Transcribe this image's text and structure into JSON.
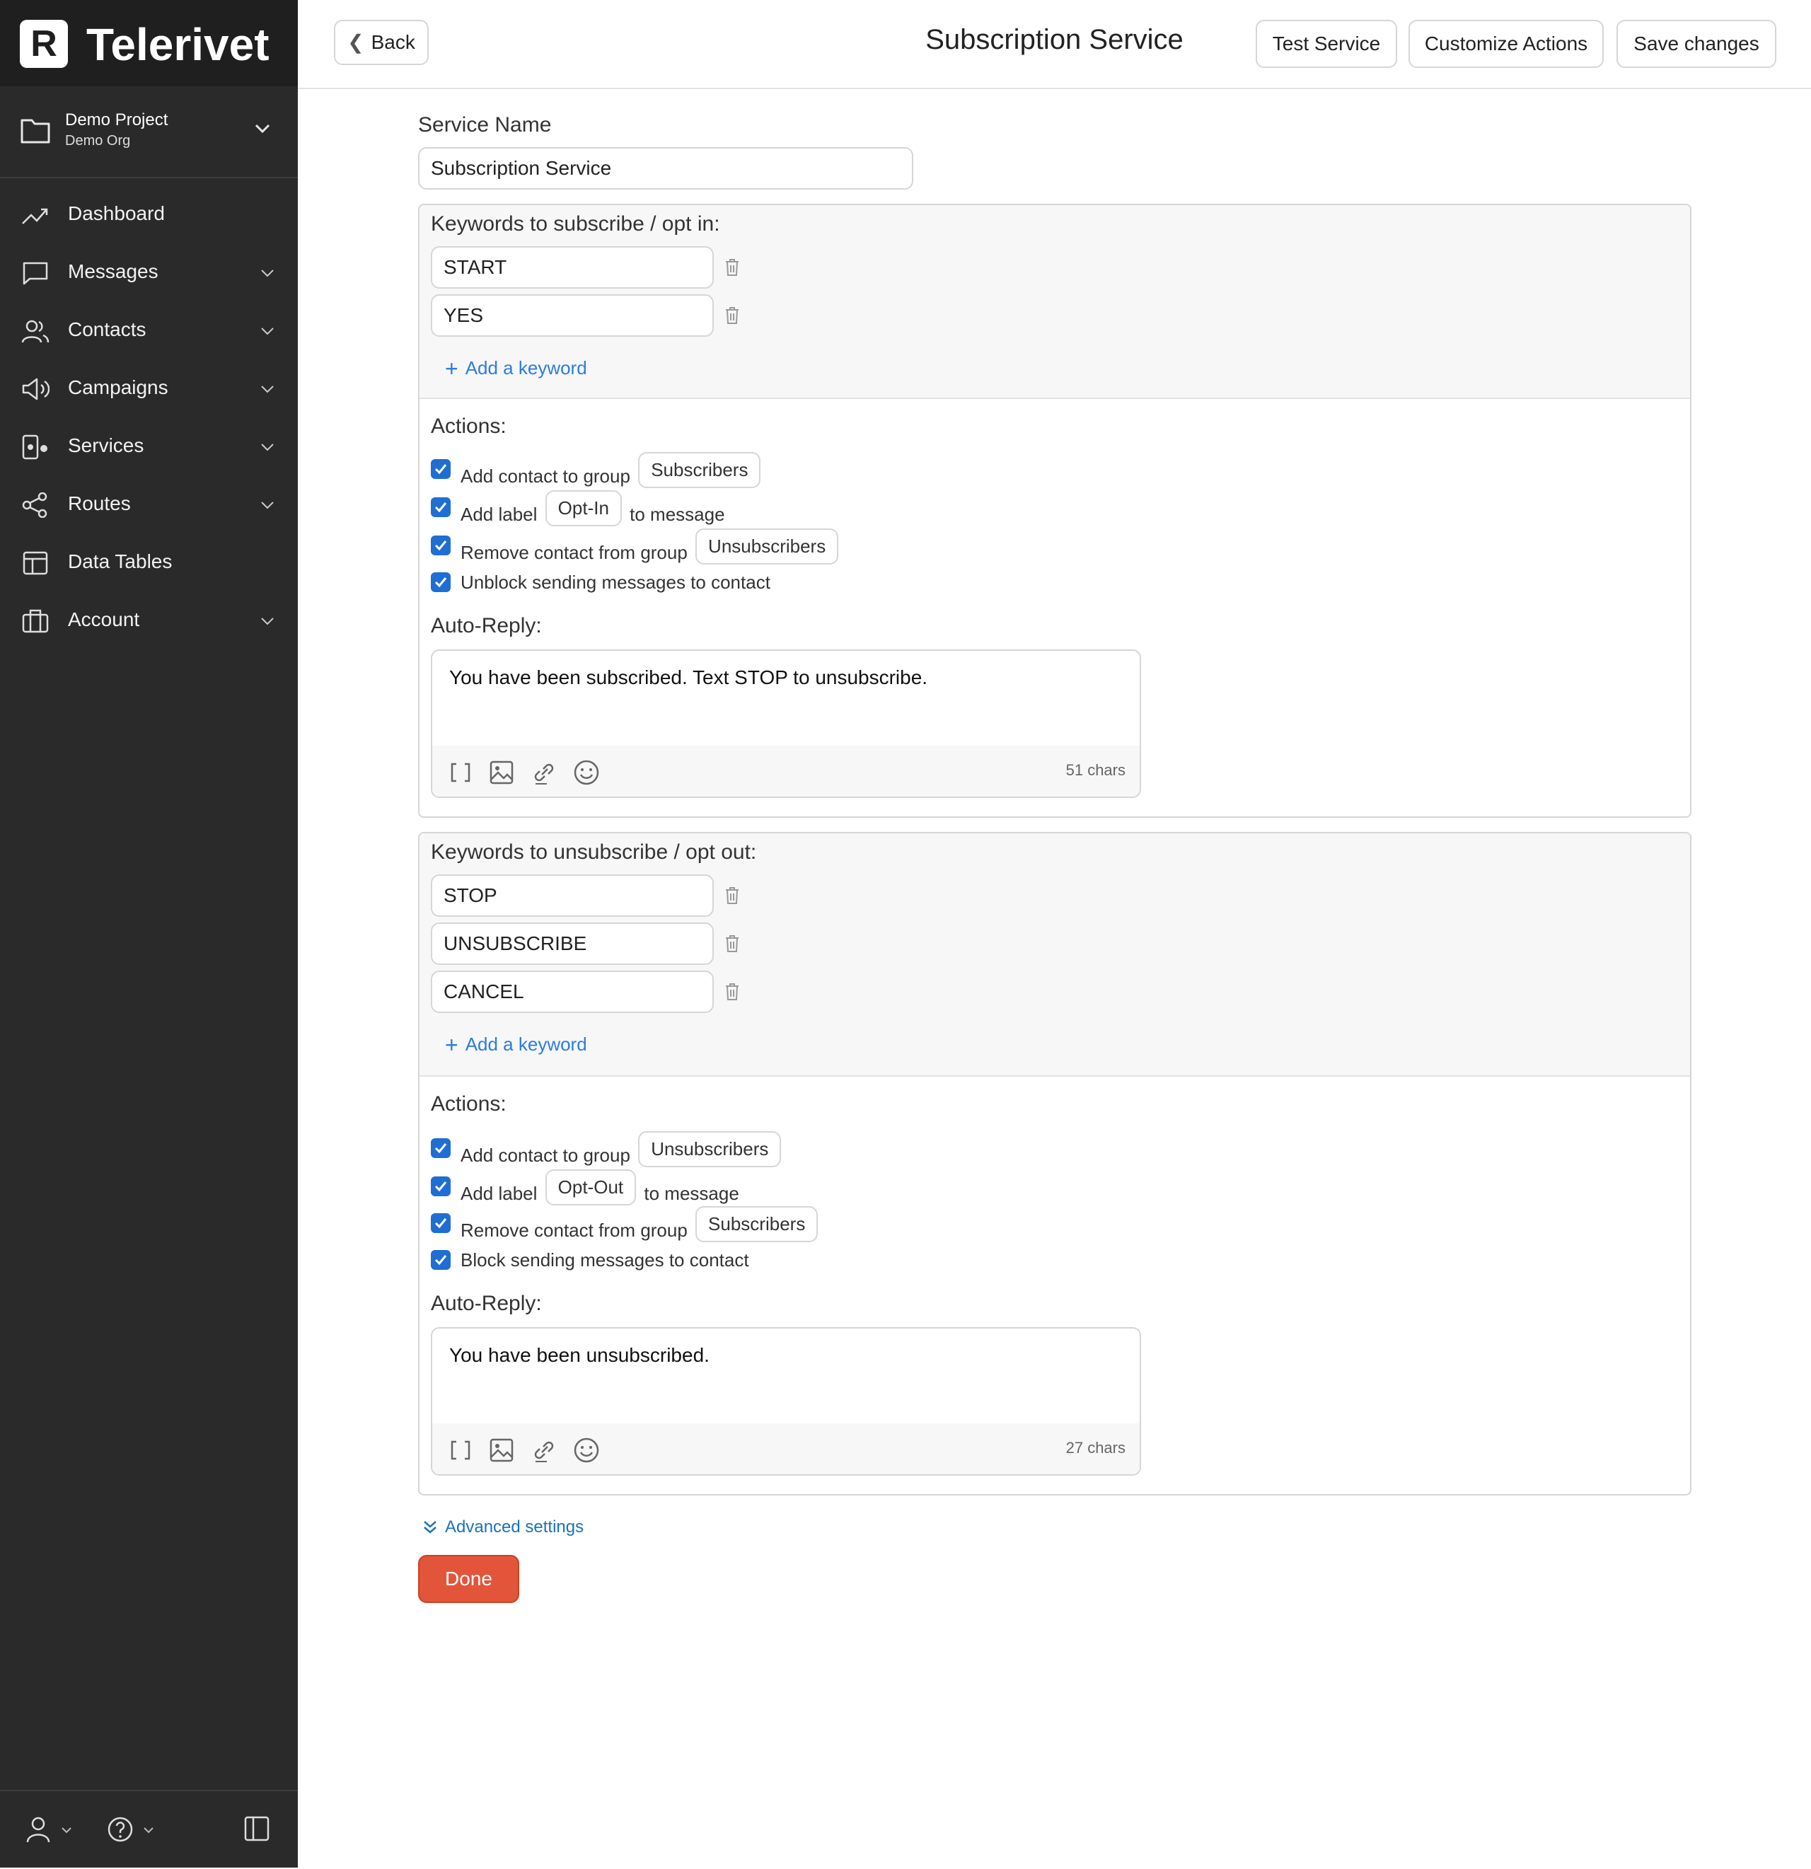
{
  "brand": {
    "name": "Telerivet",
    "logo_letter": "R"
  },
  "project": {
    "name": "Demo Project",
    "org": "Demo Org"
  },
  "nav": [
    {
      "label": "Dashboard",
      "icon": "trend-icon",
      "expandable": false
    },
    {
      "label": "Messages",
      "icon": "message-icon",
      "expandable": true
    },
    {
      "label": "Contacts",
      "icon": "contacts-icon",
      "expandable": true
    },
    {
      "label": "Campaigns",
      "icon": "megaphone-icon",
      "expandable": true
    },
    {
      "label": "Services",
      "icon": "services-icon",
      "expandable": true
    },
    {
      "label": "Routes",
      "icon": "share-icon",
      "expandable": true
    },
    {
      "label": "Data Tables",
      "icon": "table-icon",
      "expandable": false
    },
    {
      "label": "Account",
      "icon": "briefcase-icon",
      "expandable": true
    }
  ],
  "topbar": {
    "back_label": "Back",
    "title": "Subscription Service",
    "test_label": "Test Service",
    "customize_label": "Customize Actions",
    "save_label": "Save changes"
  },
  "form": {
    "service_name_label": "Service Name",
    "service_name_value": "Subscription Service",
    "subscribe": {
      "keywords_title": "Keywords to subscribe / opt in:",
      "keywords": [
        "START",
        "YES"
      ],
      "add_keyword": "Add a keyword",
      "actions_title": "Actions:",
      "actions": {
        "add_group_pre": "Add contact to group",
        "add_group_value": "Subscribers",
        "label_pre": "Add label",
        "label_value": "Opt-In",
        "label_post": "to message",
        "remove_group_pre": "Remove contact from group",
        "remove_group_value": "Unsubscribers",
        "block_text": "Unblock sending messages to contact"
      },
      "autoreply_title": "Auto-Reply:",
      "autoreply_text": "You have been subscribed. Text STOP to unsubscribe.",
      "chars": "51 chars"
    },
    "unsubscribe": {
      "keywords_title": "Keywords to unsubscribe / opt out:",
      "keywords": [
        "STOP",
        "UNSUBSCRIBE",
        "CANCEL"
      ],
      "add_keyword": "Add a keyword",
      "actions_title": "Actions:",
      "actions": {
        "add_group_pre": "Add contact to group",
        "add_group_value": "Unsubscribers",
        "label_pre": "Add label",
        "label_value": "Opt-Out",
        "label_post": "to message",
        "remove_group_pre": "Remove contact from group",
        "remove_group_value": "Subscribers",
        "block_text": "Block sending messages to contact"
      },
      "autoreply_title": "Auto-Reply:",
      "autoreply_text": "You have been unsubscribed.",
      "chars": "27 chars"
    },
    "advanced_label": "Advanced settings",
    "done_label": "Done"
  },
  "colors": {
    "accent": "#2a7de1",
    "checkbox": "#1f6ed4",
    "done": "#e2553a",
    "sidebar": "#2a2a2a"
  }
}
